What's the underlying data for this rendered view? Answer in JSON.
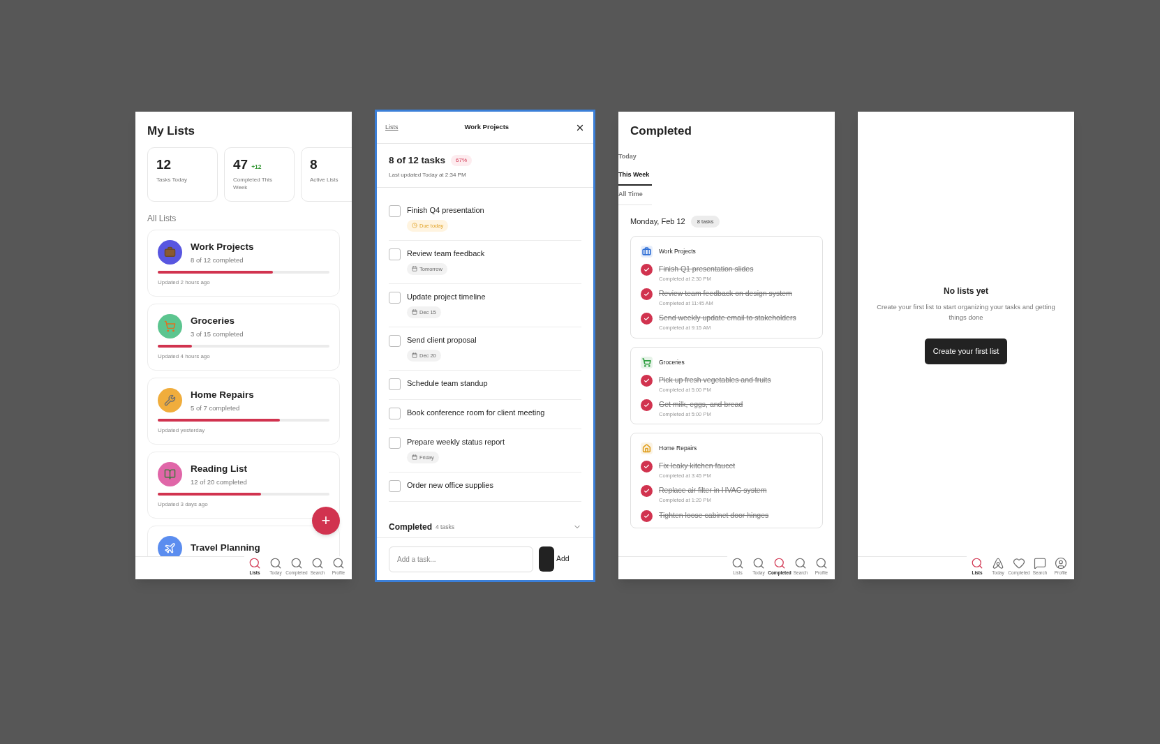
{
  "lists_screen": {
    "title": "My Lists",
    "stats": [
      {
        "value": "12",
        "label": "Tasks Today"
      },
      {
        "value": "47",
        "delta": "+12",
        "label": "Completed This Week"
      },
      {
        "value": "8",
        "label": "Active Lists"
      }
    ],
    "section_title": "All Lists",
    "lists": [
      {
        "name": "Work Projects",
        "progress": "8 of 12 completed",
        "level": 0.67,
        "updated": "Updated 2 hours ago",
        "color": "#5856e0",
        "kind": "briefcase"
      },
      {
        "name": "Groceries",
        "progress": "3 of 15 completed",
        "level": 0.2,
        "updated": "Updated 4 hours ago",
        "color": "#5cc58f",
        "kind": "cart"
      },
      {
        "name": "Home Repairs",
        "progress": "5 of 7 completed",
        "level": 0.71,
        "updated": "Updated yesterday",
        "color": "#f0ad3c",
        "kind": "wrench"
      },
      {
        "name": "Reading List",
        "progress": "12 of 20 completed",
        "level": 0.6,
        "updated": "Updated 3 days ago",
        "color": "#e066a8",
        "kind": "books"
      },
      {
        "name": "Travel Planning",
        "color": "#5b8def",
        "kind": "plane"
      }
    ],
    "fab": "+",
    "nav": [
      {
        "label": "Lists",
        "selected": true,
        "kind": "search"
      },
      {
        "label": "Today",
        "selected": false,
        "kind": "search"
      },
      {
        "label": "Completed",
        "selected": false,
        "kind": "search"
      },
      {
        "label": "Search",
        "selected": false,
        "kind": "search"
      },
      {
        "label": "Profile",
        "selected": false,
        "kind": "search"
      }
    ]
  },
  "detail_screen": {
    "back": "Lists",
    "title": "Work Projects",
    "summary": "8 of 12 tasks",
    "percent": "67%",
    "last_updated": "Last updated Today at 2:34 PM",
    "tasks": [
      {
        "title": "Finish Q4 presentation",
        "checked": false,
        "due": "Due today",
        "kind": "urgent"
      },
      {
        "title": "Review team feedback",
        "checked": false,
        "due": "Tomorrow",
        "kind": "date"
      },
      {
        "title": "Update project timeline",
        "checked": false,
        "due": "Dec 15",
        "kind": "date"
      },
      {
        "title": "Send client proposal",
        "checked": false,
        "due": "Dec 20",
        "kind": "date"
      },
      {
        "title": "Schedule team standup",
        "checked": false
      },
      {
        "title": "Book conference room for client meeting",
        "checked": false
      },
      {
        "title": "Prepare weekly status report",
        "checked": false,
        "due": "Friday",
        "kind": "date"
      },
      {
        "title": "Order new office supplies",
        "checked": false
      }
    ],
    "completed_title": "Completed",
    "completed_count": "4 tasks",
    "completed_expanded": false,
    "add_placeholder": "Add a task...",
    "add_button": "Add"
  },
  "completed_screen": {
    "title": "Completed",
    "tabs": [
      {
        "label": "Today",
        "selected": false
      },
      {
        "label": "This Week",
        "selected": true
      },
      {
        "label": "All Time",
        "selected": false
      }
    ],
    "date": "Monday, Feb 12",
    "date_count": "8 tasks",
    "groups": [
      {
        "name": "Work Projects",
        "kind": "briefcase",
        "color": "#2f6fd6",
        "items": [
          {
            "title": "Finish Q1 presentation slides",
            "time": "Completed at 2:30 PM",
            "checked": true
          },
          {
            "title": "Review team feedback on design system",
            "time": "Completed at 11:45 AM",
            "checked": true
          },
          {
            "title": "Send weekly update email to stakeholders",
            "time": "Completed at 9:15 AM",
            "checked": true
          }
        ]
      },
      {
        "name": "Groceries",
        "kind": "cart",
        "color": "#2e9e3f",
        "items": [
          {
            "title": "Pick up fresh vegetables and fruits",
            "time": "Completed at 5:00 PM",
            "checked": true
          },
          {
            "title": "Get milk, eggs, and bread",
            "time": "Completed at 5:00 PM",
            "checked": true
          }
        ]
      },
      {
        "name": "Home Repairs",
        "kind": "home",
        "color": "#e0a020",
        "items": [
          {
            "title": "Fix leaky kitchen faucet",
            "time": "Completed at 3:45 PM",
            "checked": true
          },
          {
            "title": "Replace air filter in HVAC system",
            "time": "Completed at 1:20 PM",
            "checked": true
          },
          {
            "title": "Tighten loose cabinet door hinges",
            "checked": true
          }
        ]
      }
    ],
    "nav": [
      {
        "label": "Lists",
        "selected": false,
        "kind": "search"
      },
      {
        "label": "Today",
        "selected": false,
        "kind": "search"
      },
      {
        "label": "Completed",
        "selected": true,
        "kind": "search"
      },
      {
        "label": "Search",
        "selected": false,
        "kind": "search"
      },
      {
        "label": "Profile",
        "selected": false,
        "kind": "search"
      }
    ]
  },
  "empty_screen": {
    "title": "No lists yet",
    "description": "Create your first list to start organizing your tasks and getting things done",
    "button": "Create your first list",
    "nav": [
      {
        "label": "Lists",
        "selected": true,
        "kind": "search"
      },
      {
        "label": "Today",
        "selected": false,
        "kind": "arch"
      },
      {
        "label": "Completed",
        "selected": false,
        "kind": "heart"
      },
      {
        "label": "Search",
        "selected": false,
        "kind": "chat"
      },
      {
        "label": "Profile",
        "selected": false,
        "kind": "person"
      }
    ]
  }
}
